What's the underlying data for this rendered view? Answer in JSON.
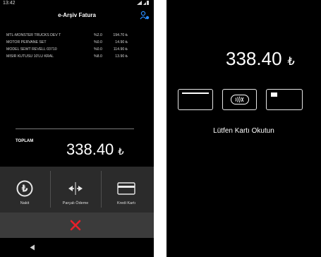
{
  "status_bar": {
    "time": "13:42"
  },
  "header": {
    "title": "e-Arşiv Fatura"
  },
  "items": [
    {
      "name": "MTL-MONSTER TRUCKS DEV T",
      "tax": "%2.0",
      "price": "194.70 ₺"
    },
    {
      "name": "MOTOR PERVANE SET",
      "tax": "%0.0",
      "price": "14.90 ₺"
    },
    {
      "name": "MODEL SEWT REVELL 03710",
      "tax": "%0.0",
      "price": "114.90 ₺"
    },
    {
      "name": "MISIR KUTUSU 10'LU KRAL",
      "tax": "%8.0",
      "price": "13.90 ₺"
    }
  ],
  "total": {
    "label": "TOPLAM",
    "amount": "338.40",
    "currency": "₺"
  },
  "payment_options": {
    "cash": "Nakit",
    "split": "Parçalı Ödeme",
    "card": "Kredi Kartı"
  },
  "card_reader": {
    "amount": "338.40",
    "currency": "₺",
    "message": "Lütfen Kartı Okutun"
  },
  "icons": {
    "cancel": "close-icon",
    "nfc": "contactless-icon",
    "user_settings": "user-settings-icon"
  },
  "colors": {
    "cancel": "#e8202a",
    "accent": "#2a8cff"
  }
}
